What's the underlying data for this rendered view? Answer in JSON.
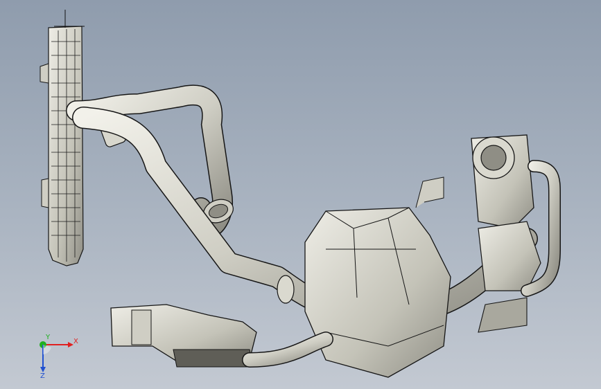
{
  "triad": {
    "x_label": "X",
    "y_label": "Y",
    "z_label": "Z",
    "x_color": "#e02020",
    "y_color": "#20b020",
    "z_color": "#2050d0"
  },
  "colors": {
    "background_top": "#8f9cad",
    "background_bottom": "#c3c9d2",
    "part_light": "#e6e5dc",
    "part_mid": "#c9c8bd",
    "part_dark": "#8d8c82",
    "edge": "#141414"
  }
}
